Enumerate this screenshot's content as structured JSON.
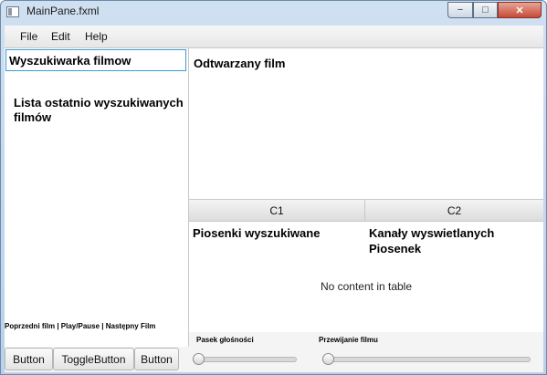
{
  "window": {
    "title": "MainPane.fxml",
    "min_symbol": "−",
    "max_symbol": "□",
    "close_symbol": "✕"
  },
  "menu": [
    "File",
    "Edit",
    "Help"
  ],
  "left_panel": {
    "search_value": "Wyszukiwarka filmow",
    "recent_label": "Lista ostatnio wyszukiwanych filmów",
    "controls_label": "Poprzedni film | Play/Pause | Następny Film"
  },
  "player": {
    "now_playing_label": "Odtwarzany film"
  },
  "table": {
    "columns": [
      "C1",
      "C2"
    ],
    "cell_labels": [
      "Piosenki wyszukiwane",
      "Kanały wyswietlanych Piosenek"
    ],
    "placeholder": "No content in table"
  },
  "sliders": {
    "volume_label": "Pasek głośności",
    "volume_value": 0,
    "seek_label": "Przewijanie filmu",
    "seek_value": 0
  },
  "buttons": [
    "Button",
    "ToggleButton",
    "Button"
  ]
}
